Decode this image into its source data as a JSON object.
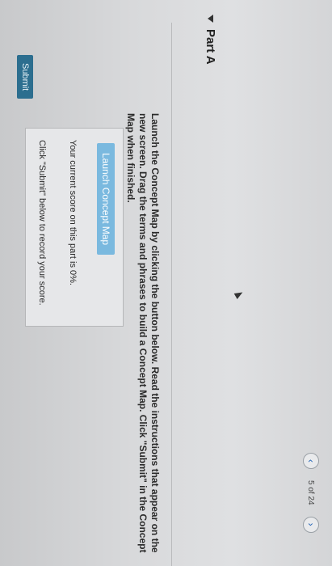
{
  "pager": {
    "prev_icon": "chevron-left-icon",
    "next_icon": "chevron-right-icon",
    "prev_glyph": "‹",
    "next_glyph": "›",
    "position_text": "5 of 24"
  },
  "part": {
    "title": "Part A"
  },
  "instructions": {
    "text": "Launch the Concept Map by clicking the button below. Read the instructions that appear on the new screen. Drag the terms and phrases to build a Concept Map. Click \"Submit\" in the Concept Map when finished."
  },
  "concept_box": {
    "launch_label": "Launch Concept Map",
    "score_text": "Your current score on this part is 0%.",
    "note_text": "Click \"Submit\" below to record your score."
  },
  "submit": {
    "label": "Submit"
  },
  "colors": {
    "launch_button": "#7ab9df",
    "submit_button": "#2c6e8f"
  }
}
